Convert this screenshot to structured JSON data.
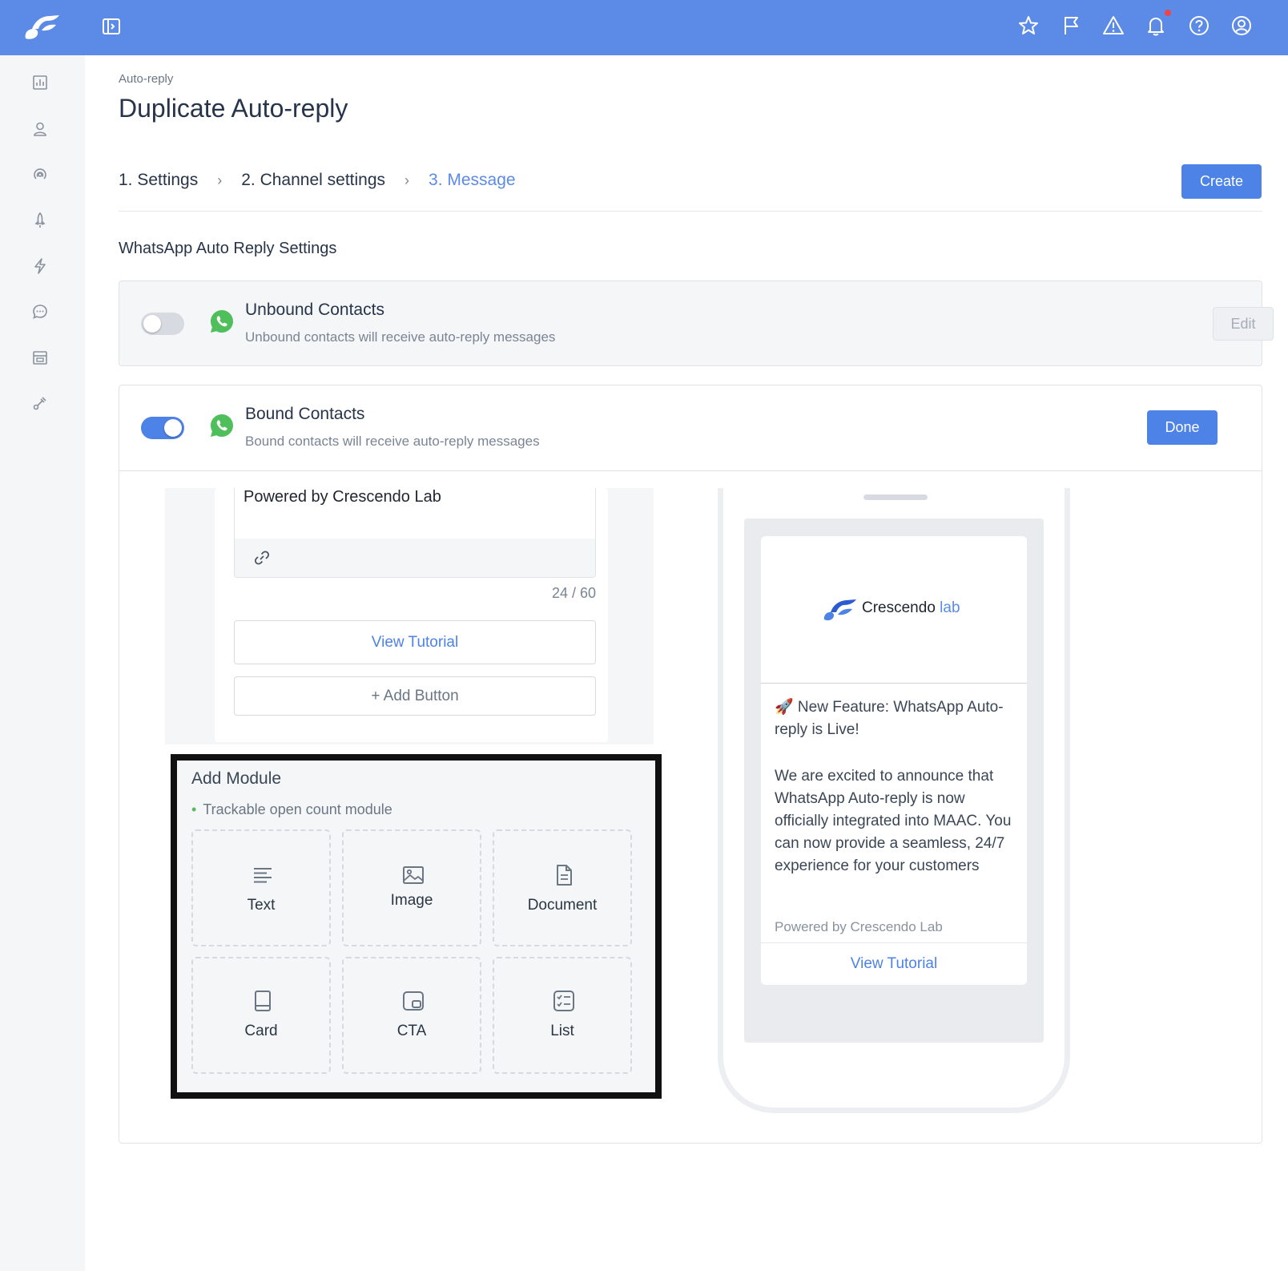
{
  "colors": {
    "primary": "#4d82e6",
    "topbar": "#5b8ae7",
    "whatsapp": "#4fbf5c",
    "sidebar": "#f5f6f8"
  },
  "topbar": {
    "icons": [
      "logo-icon",
      "panel-toggle-icon",
      "star-icon",
      "flag-icon",
      "warning-icon",
      "bell-icon",
      "help-icon",
      "user-account-icon"
    ]
  },
  "sidebar": {
    "icons": [
      "analytics-icon",
      "contacts-icon",
      "broadcast-icon",
      "campaign-icon",
      "automation-icon",
      "chat-icon",
      "store-icon",
      "integration-icon"
    ]
  },
  "page": {
    "breadcrumb": "Auto-reply",
    "title": "Duplicate Auto-reply",
    "steps": [
      "1. Settings",
      "2. Channel settings",
      "3. Message"
    ],
    "active_step": 3,
    "create_label": "Create",
    "section_title": "WhatsApp Auto Reply Settings"
  },
  "unbound": {
    "enabled": false,
    "title": "Unbound Contacts",
    "desc": "Unbound contacts will receive auto-reply messages",
    "edit_label": "Edit"
  },
  "bound": {
    "enabled": true,
    "title": "Bound Contacts",
    "desc": "Bound contacts will receive auto-reply messages",
    "done_label": "Done"
  },
  "editor": {
    "footer_text": "Powered by Crescendo Lab",
    "counter": "24 / 60",
    "view_tutorial_label": "View Tutorial",
    "add_button_label": "+ Add Button"
  },
  "add_module": {
    "title": "Add Module",
    "note": "Trackable open count module",
    "tiles": [
      "Text",
      "Image",
      "Document",
      "Card",
      "CTA",
      "List"
    ]
  },
  "preview": {
    "brand_name": "Crescendo",
    "brand_suffix": "lab",
    "title": "🚀 New Feature: WhatsApp Auto-reply is Live!",
    "body": "We are excited to announce that WhatsApp Auto-reply is now officially integrated into MAAC. You can now provide a seamless, 24/7 experience for your customers",
    "footer": "Powered by Crescendo Lab",
    "button": "View Tutorial"
  }
}
